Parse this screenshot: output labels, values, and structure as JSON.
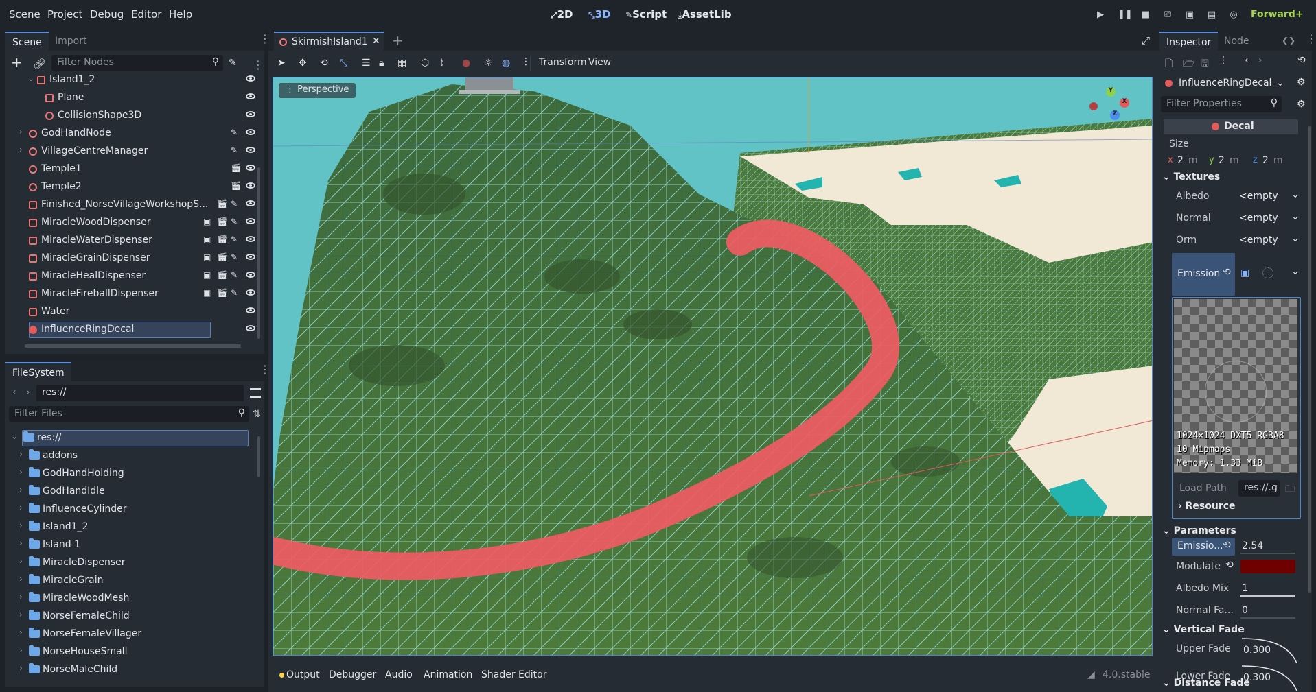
{
  "menu": {
    "items": [
      "Scene",
      "Project",
      "Debug",
      "Editor",
      "Help"
    ]
  },
  "workspaces": {
    "w2d": "2D",
    "w3d": "3D",
    "script": "Script",
    "assetlib": "AssetLib"
  },
  "renderer": "Forward+",
  "scene_panel": {
    "tabs": [
      "Scene",
      "Import"
    ],
    "filter_placeholder": "Filter Nodes",
    "nodes": [
      {
        "label": "Island1_2",
        "indent": 2,
        "icon": "node3d-box-icon",
        "expanded": true,
        "extra": []
      },
      {
        "label": "Plane",
        "indent": 3,
        "icon": "mesh-instance-icon",
        "expanded": null,
        "extra": []
      },
      {
        "label": "CollisionShape3D",
        "indent": 3,
        "icon": "collision-shape-icon",
        "expanded": null,
        "extra": []
      },
      {
        "label": "GodHandNode",
        "indent": 1,
        "icon": "node3d-icon",
        "expanded": false,
        "extra": [
          "script"
        ]
      },
      {
        "label": "VillageCentreManager",
        "indent": 1,
        "icon": "node3d-icon",
        "expanded": false,
        "extra": [
          "script"
        ]
      },
      {
        "label": "Temple1",
        "indent": 1,
        "icon": "node3d-icon",
        "expanded": null,
        "extra": [
          "clapper"
        ]
      },
      {
        "label": "Temple2",
        "indent": 1,
        "icon": "node3d-icon",
        "expanded": null,
        "extra": [
          "clapper"
        ]
      },
      {
        "label": "Finished_NorseVillageWorkshopS...",
        "indent": 1,
        "icon": "node3d-box-icon",
        "expanded": null,
        "extra": [
          "clapper",
          "script"
        ]
      },
      {
        "label": "MiracleWoodDispenser",
        "indent": 1,
        "icon": "node3d-box-icon",
        "expanded": null,
        "extra": [
          "group",
          "clapper",
          "script"
        ]
      },
      {
        "label": "MiracleWaterDispenser",
        "indent": 1,
        "icon": "node3d-box-icon",
        "expanded": null,
        "extra": [
          "group",
          "clapper",
          "script"
        ]
      },
      {
        "label": "MiracleGrainDispenser",
        "indent": 1,
        "icon": "node3d-box-icon",
        "expanded": null,
        "extra": [
          "group",
          "clapper",
          "script"
        ]
      },
      {
        "label": "MiracleHealDispenser",
        "indent": 1,
        "icon": "node3d-box-icon",
        "expanded": null,
        "extra": [
          "group",
          "clapper",
          "script"
        ]
      },
      {
        "label": "MiracleFireballDispenser",
        "indent": 1,
        "icon": "node3d-box-icon",
        "expanded": null,
        "extra": [
          "group",
          "clapper",
          "script"
        ]
      },
      {
        "label": "Water",
        "indent": 1,
        "icon": "mesh-instance-icon",
        "expanded": null,
        "extra": []
      },
      {
        "label": "InfluenceRingDecal",
        "indent": 1,
        "icon": "decal-icon",
        "expanded": null,
        "extra": []
      }
    ]
  },
  "filesystem": {
    "tab": "FileSystem",
    "path": "res://",
    "filter_placeholder": "Filter Files",
    "root": "res://",
    "folders": [
      "addons",
      "GodHandHolding",
      "GodHandIdle",
      "InfluenceCylinder",
      "Island1_2",
      "Island 1",
      "MiracleDispenser",
      "MiracleGrain",
      "MiracleWoodMesh",
      "NorseFemaleChild",
      "NorseFemaleVillager",
      "NorseHouseSmall",
      "NorseMaleChild"
    ]
  },
  "editor_tab": {
    "label": "SkirmishIsland1"
  },
  "viewport_toolbar": {
    "transform": "Transform",
    "view": "View"
  },
  "viewport": {
    "perspective": "Perspective",
    "gizmo": {
      "x": "X",
      "y": "Y",
      "z": "Z"
    }
  },
  "bottom": {
    "tabs": [
      "Output",
      "Debugger",
      "Audio",
      "Animation",
      "Shader Editor"
    ],
    "version": "4.0.stable"
  },
  "inspector": {
    "tabs": [
      "Inspector",
      "Node"
    ],
    "node_name": "InfluenceRingDecal",
    "filter_placeholder": "Filter Properties",
    "class_name": "Decal",
    "size_label": "Size",
    "size": {
      "x_label": "x",
      "x": "2",
      "x_unit": "m",
      "y_label": "y",
      "y": "2",
      "y_unit": "m",
      "z_label": "z",
      "z": "2",
      "z_unit": "m"
    },
    "textures_header": "Textures",
    "albedo": {
      "label": "Albedo",
      "value": "<empty"
    },
    "normal": {
      "label": "Normal",
      "value": "<empty"
    },
    "orm": {
      "label": "Orm",
      "value": "<empty"
    },
    "emission": {
      "label": "Emission"
    },
    "texture_info": [
      "1024×1024 DXT5 RGBA8",
      "10 Mipmaps",
      "Memory: 1.33 MiB"
    ],
    "load_path": {
      "label": "Load Path",
      "value": "res://.g"
    },
    "resource_header": "Resource",
    "parameters_header": "Parameters",
    "emission_energy": {
      "label": "Emissio...",
      "value": "2.54"
    },
    "modulate": {
      "label": "Modulate",
      "color": "#6e0000"
    },
    "albedo_mix": {
      "label": "Albedo Mix",
      "value": "1"
    },
    "normal_fade": {
      "label": "Normal Fa...",
      "value": "0"
    },
    "vertical_fade_header": "Vertical Fade",
    "upper_fade": {
      "label": "Upper Fade",
      "value": "0.300"
    },
    "lower_fade": {
      "label": "Lower Fade",
      "value": "0.300"
    },
    "distance_fade_header": "Distance Fade"
  },
  "colors": {
    "accent": "#5a8fe0",
    "node_red": "#f07b7b",
    "folder": "#6fa8e8",
    "renderer": "#a5d651"
  }
}
